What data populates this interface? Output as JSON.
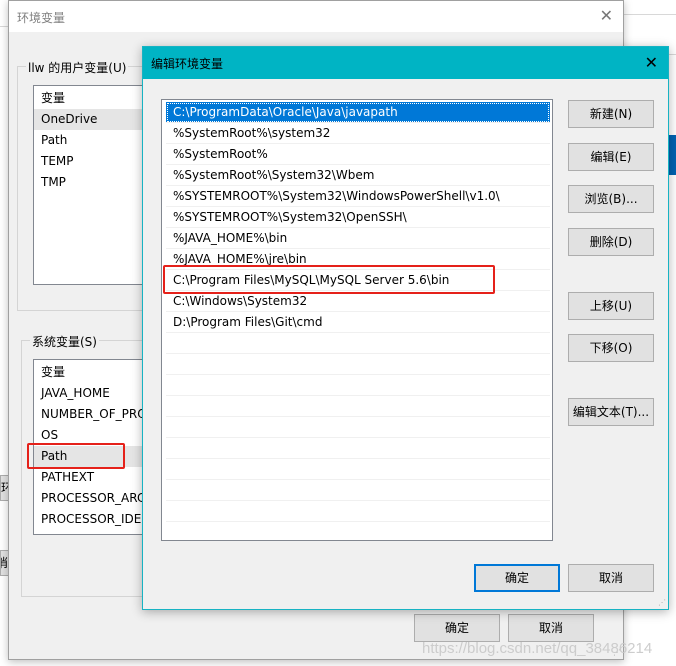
{
  "outer": {
    "title": "环境变量",
    "user_group": "llw 的用户变量(U)",
    "user_vars": [
      "变量",
      "OneDrive",
      "Path",
      "TEMP",
      "TMP"
    ],
    "system_group": "系统变量(S)",
    "system_vars": [
      "变量",
      "JAVA_HOME",
      "NUMBER_OF_PRO",
      "OS",
      "Path",
      "PATHEXT",
      "PROCESSOR_ARC",
      "PROCESSOR_IDEN"
    ],
    "ok": "确定",
    "cancel": "取消",
    "bg_fragments": [
      "环",
      "消"
    ]
  },
  "inner": {
    "title": "编辑环境变量",
    "paths": [
      "C:\\ProgramData\\Oracle\\Java\\javapath",
      "%SystemRoot%\\system32",
      "%SystemRoot%",
      "%SystemRoot%\\System32\\Wbem",
      "%SYSTEMROOT%\\System32\\WindowsPowerShell\\v1.0\\",
      "%SYSTEMROOT%\\System32\\OpenSSH\\",
      "%JAVA_HOME%\\bin",
      "%JAVA_HOME%\\jre\\bin",
      "C:\\Program Files\\MySQL\\MySQL Server 5.6\\bin",
      "C:\\Windows\\System32",
      "D:\\Program Files\\Git\\cmd"
    ],
    "buttons": {
      "new": "新建(N)",
      "edit": "编辑(E)",
      "browse": "浏览(B)...",
      "delete": "删除(D)",
      "up": "上移(U)",
      "down": "下移(O)",
      "edit_text": "编辑文本(T)..."
    },
    "ok": "确定",
    "cancel": "取消"
  },
  "watermark": "https://blog.csdn.net/qq_38486214",
  "colors": {
    "title_accent": "#00b4c4",
    "selection": "#0078d7",
    "highlight_box": "#e5211a"
  }
}
